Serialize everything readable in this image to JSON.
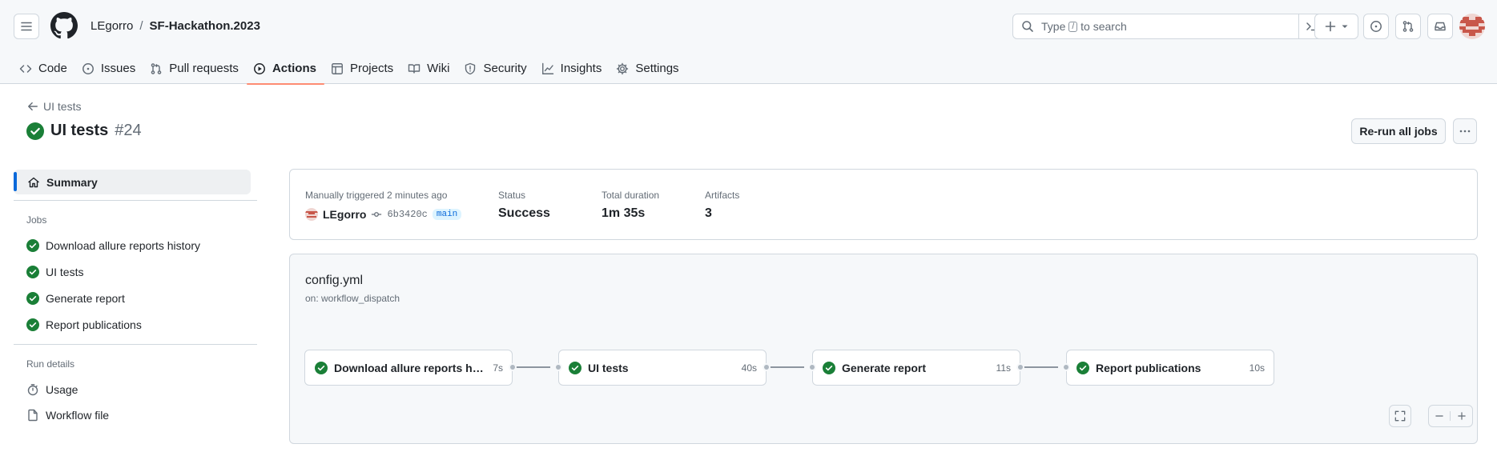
{
  "header": {
    "owner": "LEgorro",
    "separator": "/",
    "repo": "SF-Hackathon.2023",
    "search": {
      "prefix": "Type",
      "key": "/",
      "suffix": "to search"
    }
  },
  "tabs": [
    {
      "label": "Code",
      "icon": "code-icon"
    },
    {
      "label": "Issues",
      "icon": "issue-opened-icon"
    },
    {
      "label": "Pull requests",
      "icon": "git-pull-request-icon"
    },
    {
      "label": "Actions",
      "icon": "play-icon",
      "active": true
    },
    {
      "label": "Projects",
      "icon": "table-icon"
    },
    {
      "label": "Wiki",
      "icon": "book-icon"
    },
    {
      "label": "Security",
      "icon": "shield-icon"
    },
    {
      "label": "Insights",
      "icon": "graph-icon"
    },
    {
      "label": "Settings",
      "icon": "gear-icon"
    }
  ],
  "run": {
    "back_label": "UI tests",
    "title": "UI tests",
    "number": "#24",
    "rerun_label": "Re-run all jobs",
    "status_color": "#1a7f37"
  },
  "sidebar": {
    "summary_label": "Summary",
    "jobs_heading": "Jobs",
    "jobs": [
      {
        "label": "Download allure reports history"
      },
      {
        "label": "UI tests"
      },
      {
        "label": "Generate report"
      },
      {
        "label": "Report publications"
      }
    ],
    "run_details_heading": "Run details",
    "details": [
      {
        "label": "Usage",
        "icon": "stopwatch-icon"
      },
      {
        "label": "Workflow file",
        "icon": "file-icon"
      }
    ]
  },
  "summary": {
    "trigger_label": "Manually triggered 2 minutes ago",
    "user": "LEgorro",
    "commit": "6b3420c",
    "branch": "main",
    "status_label": "Status",
    "status_value": "Success",
    "duration_label": "Total duration",
    "duration_value": "1m 35s",
    "artifacts_label": "Artifacts",
    "artifacts_value": "3"
  },
  "workflow": {
    "name": "config.yml",
    "trigger": "on: workflow_dispatch",
    "jobs": [
      {
        "name": "Download allure reports history",
        "duration": "7s"
      },
      {
        "name": "UI tests",
        "duration": "40s"
      },
      {
        "name": "Generate report",
        "duration": "11s"
      },
      {
        "name": "Report publications",
        "duration": "10s"
      }
    ]
  },
  "colors": {
    "accent": "#0969da",
    "success": "#1a7f37",
    "tab_underline": "#fd8c73"
  }
}
